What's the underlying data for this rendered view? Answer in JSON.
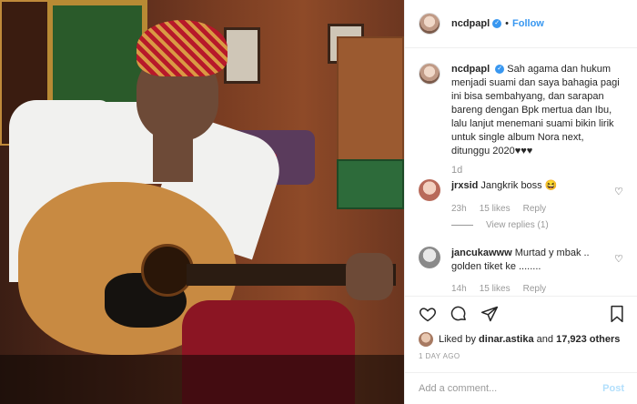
{
  "header": {
    "username": "ncdpapl",
    "separator": "•",
    "follow_label": "Follow"
  },
  "caption": {
    "username": "ncdpapl",
    "text": "Sah agama dan hukum menjadi suami dan saya bahagia pagi ini bisa sembahyang, dan sarapan bareng dengan Bpk mertua dan Ibu, lalu lanjut menemani suami bikin lirik untuk single album Nora next, ditunggu 2020♥♥♥",
    "time": "1d"
  },
  "comments": [
    {
      "username": "jrxsid",
      "text": "Jangkrik boss 😆",
      "time": "23h",
      "likes": "15 likes",
      "reply_label": "Reply",
      "view_replies": "View replies (1)"
    },
    {
      "username": "jancukawww",
      "text": "Murtad y mbak .. golden tiket ke ........",
      "time": "14h",
      "likes": "15 likes",
      "reply_label": "Reply"
    }
  ],
  "likes": {
    "prefix": "Liked by",
    "first_user": "dinar.astika",
    "middle": "and",
    "others": "17,923 others"
  },
  "date": "1 DAY AGO",
  "add_comment": {
    "placeholder": "Add a comment...",
    "post_label": "Post"
  },
  "colors": {
    "link_blue": "#3897f0",
    "post_disabled": "#b2dffc",
    "muted": "#999999"
  },
  "icons": {
    "verified": "verified-badge-icon",
    "like": "heart-icon",
    "comment": "comment-bubble-icon",
    "share": "share-paper-plane-icon",
    "save": "bookmark-icon"
  }
}
